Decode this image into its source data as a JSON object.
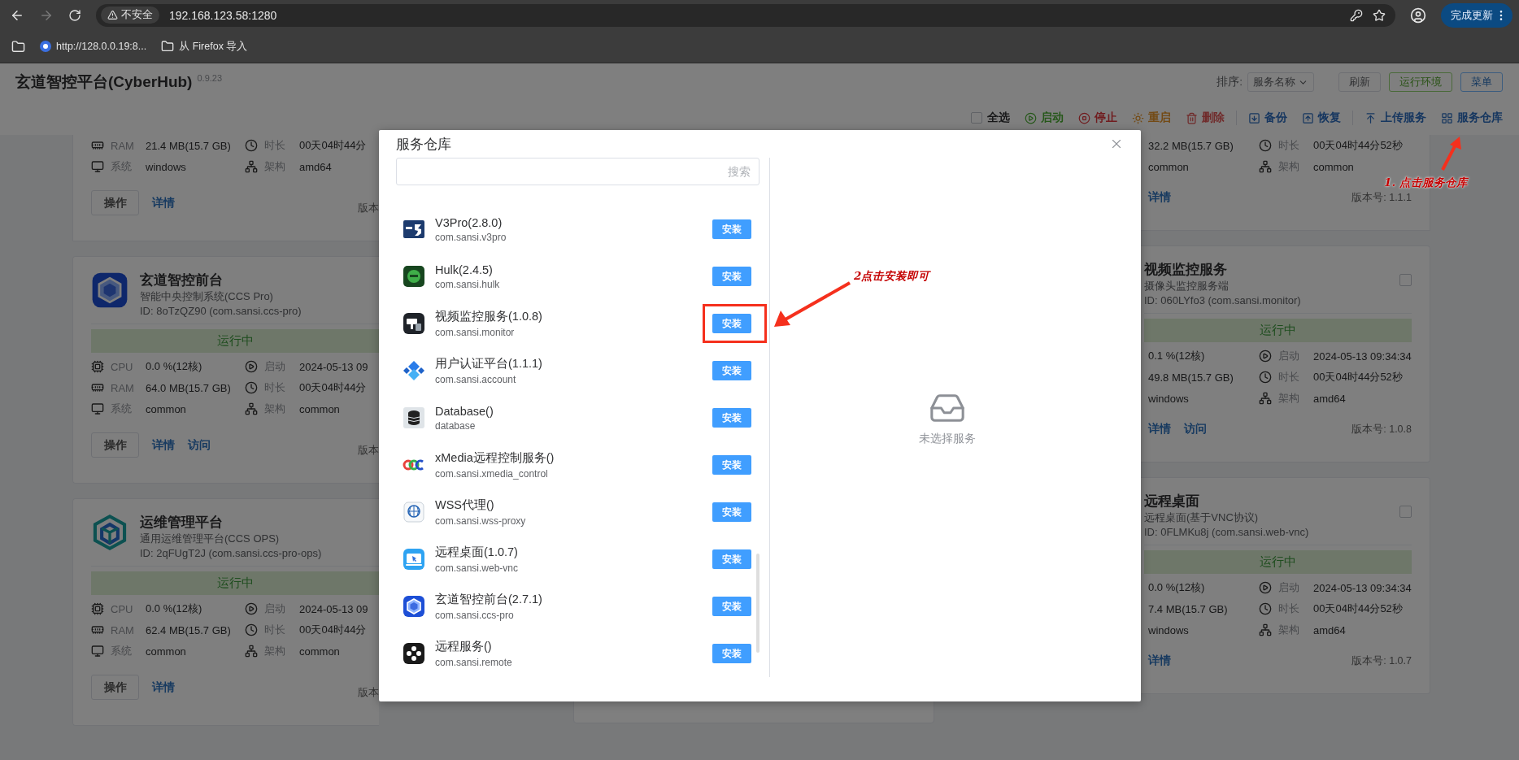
{
  "browser": {
    "security_label": "不安全",
    "url": "192.168.123.58:1280",
    "update_button": "完成更新",
    "bookmarks": [
      {
        "kind": "site",
        "label": "http://128.0.0.19:8..."
      },
      {
        "kind": "folder",
        "label": "从 Firefox 导入"
      }
    ]
  },
  "app": {
    "title": "玄道智控平台(CyberHub)",
    "version": "0.9.23",
    "sort_label": "排序:",
    "sort_value": "服务名称",
    "buttons": [
      {
        "kind": "default",
        "label": "刷新"
      },
      {
        "kind": "success",
        "label": "运行环境"
      },
      {
        "kind": "primary",
        "label": "菜单"
      }
    ]
  },
  "toolbar": {
    "groups": [
      [
        {
          "kind": "select_all",
          "label": "全选",
          "checked": false
        },
        {
          "kind": "start",
          "label": "启动"
        },
        {
          "kind": "stop",
          "label": "停止"
        },
        {
          "kind": "restart",
          "label": "重启"
        },
        {
          "kind": "delete",
          "label": "删除"
        }
      ],
      [
        {
          "kind": "backup",
          "label": "备份"
        },
        {
          "kind": "restore",
          "label": "恢复"
        }
      ],
      [
        {
          "kind": "upload",
          "label": "上传服务"
        },
        {
          "kind": "repository",
          "label": "服务仓库"
        }
      ]
    ]
  },
  "service_columns": [
    {
      "cards": [
        {
          "stats": [
            {
              "kind": "ram",
              "label": "RAM",
              "value": "21.4 MB(15.7 GB)"
            },
            {
              "kind": "uptime",
              "label": "时长",
              "value": "00天04时44分"
            },
            {
              "kind": "os",
              "label": "系统",
              "value": "windows"
            },
            {
              "kind": "arch",
              "label": "架构",
              "value": "amd64"
            }
          ],
          "operate": "操作",
          "links": [
            "详情"
          ],
          "version": "版本"
        },
        {
          "kind": "ccs",
          "title": "玄道智控前台",
          "subtitle": "智能中央控制系统(CCS Pro)",
          "id": "ID: 8oTzQZ90 (com.sansi.ccs-pro)",
          "status": "运行中",
          "stats": [
            {
              "kind": "cpu",
              "label": "CPU",
              "value": "0.0 %(12核)"
            },
            {
              "kind": "start",
              "label": "启动",
              "value": "2024-05-13 09"
            },
            {
              "kind": "ram",
              "label": "RAM",
              "value": "64.0 MB(15.7 GB)"
            },
            {
              "kind": "uptime",
              "label": "时长",
              "value": "00天04时44分"
            },
            {
              "kind": "os",
              "label": "系统",
              "value": "common"
            },
            {
              "kind": "arch",
              "label": "架构",
              "value": "common"
            }
          ],
          "operate": "操作",
          "links": [
            "详情",
            "访问"
          ],
          "version": "版本"
        },
        {
          "kind": "ops",
          "title": "运维管理平台",
          "subtitle": "通用运维管理平台(CCS OPS)",
          "id": "ID: 2qFUgT2J (com.sansi.ccs-pro-ops)",
          "status": "运行中",
          "stats": [
            {
              "kind": "cpu",
              "label": "CPU",
              "value": "0.0 %(12核)"
            },
            {
              "kind": "start",
              "label": "启动",
              "value": "2024-05-13 09"
            },
            {
              "kind": "ram",
              "label": "RAM",
              "value": "62.4 MB(15.7 GB)"
            },
            {
              "kind": "uptime",
              "label": "时长",
              "value": "00天04时44分"
            },
            {
              "kind": "os",
              "label": "系统",
              "value": "common"
            },
            {
              "kind": "arch",
              "label": "架构",
              "value": "common"
            }
          ],
          "operate": "操作",
          "links": [
            "详情"
          ],
          "version": "版本"
        }
      ]
    },
    {
      "cards": [
        {
          "stats": [
            {
              "kind": "ram",
              "value": "32.2 MB(15.7 GB)"
            },
            {
              "kind": "uptime",
              "label": "时长",
              "value": "00天04时44分52秒"
            },
            {
              "kind": "os",
              "value": "common"
            },
            {
              "kind": "arch",
              "label": "架构",
              "value": "common"
            }
          ],
          "links": [
            "详情"
          ],
          "version": "版本号: 1.1.1"
        },
        {
          "title": "视频监控服务",
          "subtitle": "摄像头监控服务端",
          "id": "ID: 060LYfo3 (com.sansi.monitor)",
          "checked": false,
          "status": "运行中",
          "stats": [
            {
              "kind": "cpu",
              "value": "0.1 %(12核)"
            },
            {
              "kind": "start",
              "label": "启动",
              "value": "2024-05-13 09:34:34"
            },
            {
              "kind": "ram",
              "value": "49.8 MB(15.7 GB)"
            },
            {
              "kind": "uptime",
              "label": "时长",
              "value": "00天04时44分52秒"
            },
            {
              "kind": "os",
              "value": "windows"
            },
            {
              "kind": "arch",
              "label": "架构",
              "value": "amd64"
            }
          ],
          "links": [
            "详情",
            "访问"
          ],
          "version": "版本号: 1.0.8"
        },
        {
          "title": "远程桌面",
          "subtitle": "远程桌面(基于VNC协议)",
          "id": "ID: 0FLMKu8j (com.sansi.web-vnc)",
          "checked": false,
          "status": "运行中",
          "stats": [
            {
              "kind": "cpu",
              "value": "0.0 %(12核)"
            },
            {
              "kind": "start",
              "label": "启动",
              "value": "2024-05-13 09:34:34"
            },
            {
              "kind": "ram",
              "value": "7.4 MB(15.7 GB)"
            },
            {
              "kind": "uptime",
              "label": "时长",
              "value": "00天04时44分52秒"
            },
            {
              "kind": "os",
              "value": "windows"
            },
            {
              "kind": "arch",
              "label": "架构",
              "value": "amd64"
            }
          ],
          "links": [
            "详情"
          ],
          "version": "版本号: 1.0.7"
        }
      ]
    }
  ],
  "modal": {
    "title": "服务仓库",
    "search": {
      "placeholder": "搜索"
    },
    "empty_text": "未选择服务",
    "items": [
      {
        "kind": "v3",
        "name": "V3Pro(2.8.0)",
        "package": "com.sansi.v3pro",
        "action": "安装",
        "highlighted": false
      },
      {
        "kind": "hulk",
        "name": "Hulk(2.4.5)",
        "package": "com.sansi.hulk",
        "action": "安装",
        "highlighted": false
      },
      {
        "kind": "monitor",
        "name": "视频监控服务(1.0.8)",
        "package": "com.sansi.monitor",
        "action": "安装",
        "highlighted": true
      },
      {
        "kind": "account",
        "name": "用户认证平台(1.1.1)",
        "package": "com.sansi.account",
        "action": "安装",
        "highlighted": false
      },
      {
        "kind": "database",
        "name": "Database()",
        "package": "database",
        "action": "安装",
        "highlighted": false
      },
      {
        "kind": "xmedia",
        "name": "xMedia远程控制服务()",
        "package": "com.sansi.xmedia_control",
        "action": "安装",
        "highlighted": false
      },
      {
        "kind": "wss",
        "name": "WSS代理()",
        "package": "com.sansi.wss-proxy",
        "action": "安装",
        "highlighted": false
      },
      {
        "kind": "vnc",
        "name": "远程桌面(1.0.7)",
        "package": "com.sansi.web-vnc",
        "action": "安装",
        "highlighted": false
      },
      {
        "kind": "ccs",
        "name": "玄道智控前台(2.7.1)",
        "package": "com.sansi.ccs-pro",
        "action": "安装",
        "highlighted": false
      },
      {
        "kind": "remote",
        "name": "远程服务()",
        "package": "com.sansi.remote",
        "action": "安装",
        "highlighted": false
      }
    ]
  },
  "annotations": [
    {
      "text": "2点击安装即可"
    },
    {
      "text": "1. 点击服务仓库"
    }
  ]
}
